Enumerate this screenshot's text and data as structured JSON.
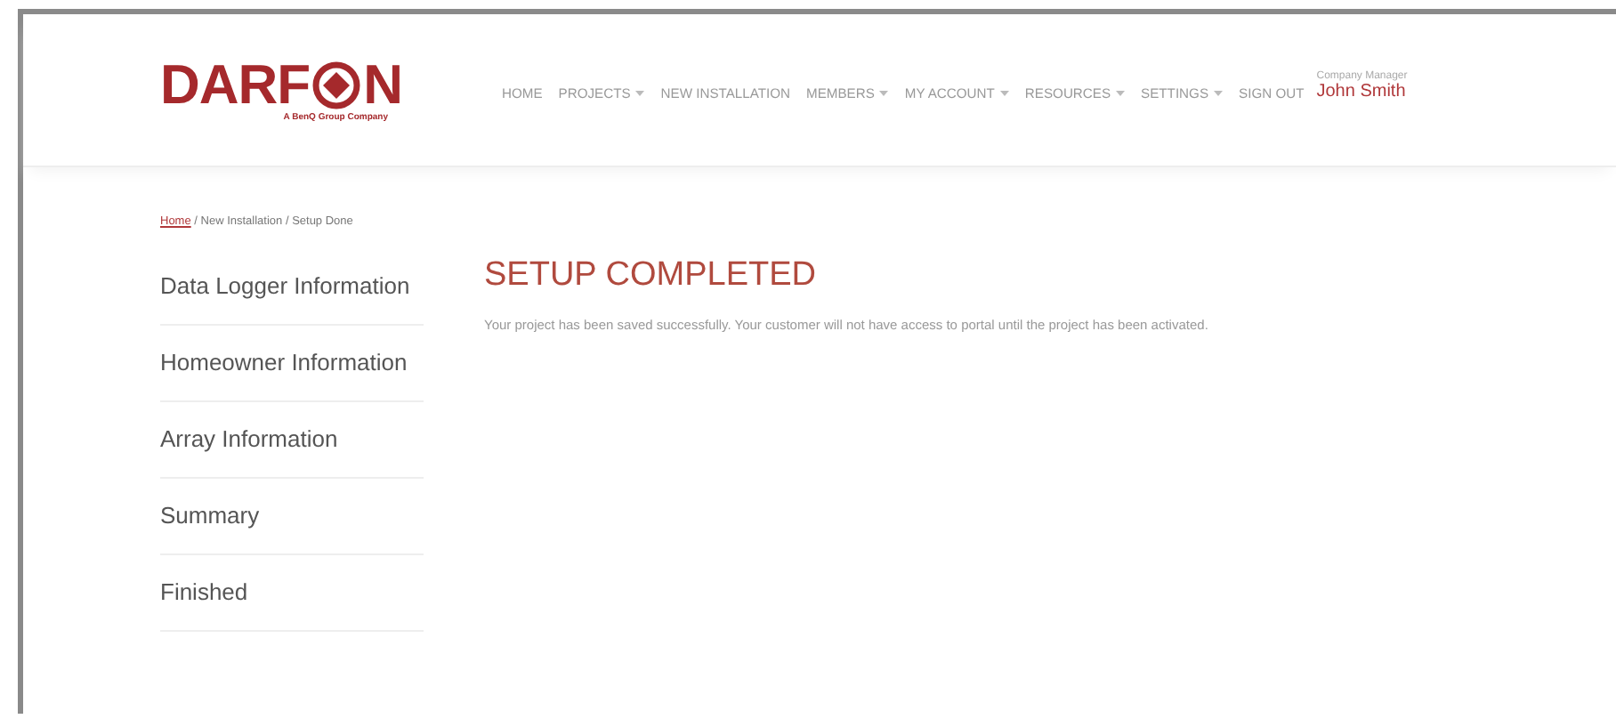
{
  "logo": {
    "before_mark": "DARF",
    "after_mark": "N",
    "tagline": "A BenQ Group Company"
  },
  "nav": [
    {
      "label": "HOME",
      "dropdown": false
    },
    {
      "label": "PROJECTS",
      "dropdown": true
    },
    {
      "label": "NEW INSTALLATION",
      "dropdown": false
    },
    {
      "label": "MEMBERS",
      "dropdown": true
    },
    {
      "label": "MY ACCOUNT",
      "dropdown": true
    },
    {
      "label": "RESOURCES",
      "dropdown": true
    },
    {
      "label": "SETTINGS",
      "dropdown": true
    },
    {
      "label": "SIGN OUT",
      "dropdown": false
    }
  ],
  "user": {
    "role": "Company Manager",
    "name": "John Smith"
  },
  "breadcrumb": {
    "link": "Home",
    "rest": " / New Installation / Setup Done"
  },
  "sidebar": {
    "items": [
      {
        "label": "Data Logger Information"
      },
      {
        "label": "Homeowner Information"
      },
      {
        "label": "Array Information"
      },
      {
        "label": "Summary"
      },
      {
        "label": "Finished"
      }
    ]
  },
  "content": {
    "title": "SETUP COMPLETED",
    "message": "Your project has been saved successfully. Your customer will not have access to portal until the project has been activated."
  }
}
